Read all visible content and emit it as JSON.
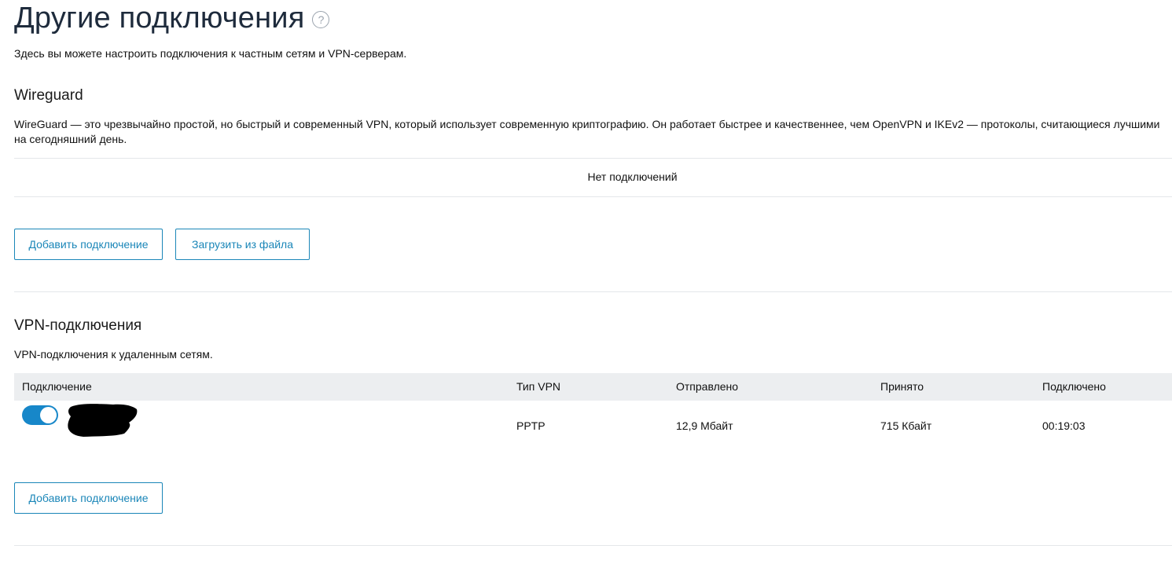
{
  "page": {
    "title": "Другие подключения",
    "help_icon": "question-circle-icon",
    "description": "Здесь вы можете настроить подключения к частным сетям и VPN-серверам."
  },
  "wireguard": {
    "title": "Wireguard",
    "description": "WireGuard — это чрезвычайно простой, но быстрый и современный VPN, который использует современную криптографию. Он работает быстрее и качественнее, чем OpenVPN и IKEv2 — протоколы, считающиеся лучшими на сегодняшний день.",
    "empty_message": "Нет подключений",
    "add_button": "Добавить подключение",
    "load_button": "Загрузить из файла"
  },
  "vpn": {
    "title": "VPN-подключения",
    "description": "VPN-подключения к удаленным сетям.",
    "columns": [
      "Подключение",
      "Тип VPN",
      "Отправлено",
      "Принято",
      "Подключено"
    ],
    "rows": [
      {
        "enabled": true,
        "name_redacted": true,
        "type": "PPTP",
        "sent": "12,9 Мбайт",
        "received": "715 Кбайт",
        "connected": "00:19:03"
      }
    ],
    "add_button": "Добавить подключение"
  },
  "colors": {
    "accent": "#1a86b8",
    "toggle_on": "#1787c9",
    "title": "#1e2b3c",
    "table_header_bg": "#eceef0"
  }
}
